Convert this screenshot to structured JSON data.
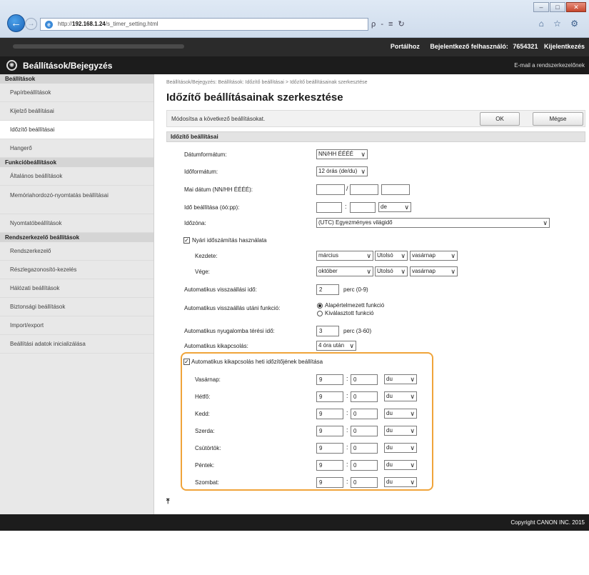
{
  "browser": {
    "url_prefix": "http://",
    "url_host": "192.168.1.24",
    "url_path": "/s_timer_setting.html",
    "addr_tools": "ρ - ≡ ↻",
    "win_min": "–",
    "win_max": "□",
    "win_close": "✕",
    "tab_icons": "⌂ ☆ ⚙"
  },
  "topbar": {
    "portal": "Portálhoz",
    "login_user": "Bejelentkező felhasználó:",
    "user_id": "7654321",
    "logout": "Kijelentkezés"
  },
  "header": {
    "title": "Beállítások/Bejegyzés",
    "mail": "E-mail a rendszerkezelőnek"
  },
  "sidebar": {
    "sections": [
      {
        "heading": "Beállítások",
        "items": [
          {
            "label": "Papírbeállítások"
          },
          {
            "label": "Kijelző beállításai"
          },
          {
            "label": "Időzítő beállításai",
            "active": true
          },
          {
            "label": "Hangerő"
          }
        ]
      },
      {
        "heading": "Funkcióbeállítások",
        "items": [
          {
            "label": "Általános beállítások"
          },
          {
            "label": "Memóriahordozó-nyomtatás beállításai"
          },
          {
            "label": "Nyomtatóbeállítások"
          }
        ]
      },
      {
        "heading": "Rendszerkezelő beállítások",
        "items": [
          {
            "label": "Rendszerkezelő"
          },
          {
            "label": "Részlegazonosító-kezelés"
          },
          {
            "label": "Hálózati beállítások"
          },
          {
            "label": "Biztonsági beállítások"
          },
          {
            "label": "Import/export"
          },
          {
            "label": "Beállítási adatok inicializálása"
          }
        ]
      }
    ]
  },
  "main": {
    "breadcrumb": "Beállítások/Bejegyzés: Beállítások: Időzítő beállításai > Időzítő beállításainak szerkesztése",
    "title": "Időzítő beállításainak szerkesztése",
    "info": "Módosítsa a következő beállításokat.",
    "ok": "OK",
    "cancel": "Mégse",
    "section_title": "Időzítő beállításai",
    "fields": {
      "date_format": {
        "label": "Dátumformátum:",
        "value": "NN/HH ÉÉÉÉ"
      },
      "time_format": {
        "label": "Időformátum:",
        "value": "12 órás (de/du)"
      },
      "today": {
        "label": "Mai dátum (NN/HH ÉÉÉÉ):",
        "sep": "/"
      },
      "time_set": {
        "label": "Idő beállítása (óó:pp):",
        "sep": ":",
        "ampm": "de"
      },
      "timezone": {
        "label": "Időzóna:",
        "value": "(UTC) Egyezményes világidő"
      },
      "dst": {
        "label": "Nyári időszámítás használata",
        "checked": "✓",
        "start_label": "Kezdete:",
        "start_month": "március",
        "start_week": "Utolsó",
        "start_day": "vasárnap",
        "end_label": "Vége:",
        "end_month": "október",
        "end_week": "Utolsó",
        "end_day": "vasárnap"
      },
      "auto_reset": {
        "label": "Automatikus visszaállási idő:",
        "value": "2",
        "unit": "perc (0-9)"
      },
      "after_reset": {
        "label": "Automatikus visszaállás utáni funkció:",
        "opt1": "Alapértelmezett funkció",
        "opt2": "Kiválasztott funkció"
      },
      "sleep": {
        "label": "Automatikus nyugalomba térési idő:",
        "value": "3",
        "unit": "perc (3-60)"
      },
      "shutdown": {
        "label": "Automatikus kikapcsolás:",
        "value": "4 óra után"
      }
    },
    "schedule": {
      "label": "Automatikus kikapcsolás heti időzítőjének beállítása",
      "checked": "✓",
      "sep": ":",
      "days": [
        {
          "label": "Vasárnap:",
          "hour": "9",
          "minute": "0",
          "ampm": "du"
        },
        {
          "label": "Hétfő:",
          "hour": "9",
          "minute": "0",
          "ampm": "du"
        },
        {
          "label": "Kedd:",
          "hour": "9",
          "minute": "0",
          "ampm": "du"
        },
        {
          "label": "Szerda:",
          "hour": "9",
          "minute": "0",
          "ampm": "du"
        },
        {
          "label": "Csütörtök:",
          "hour": "9",
          "minute": "0",
          "ampm": "du"
        },
        {
          "label": "Péntek:",
          "hour": "9",
          "minute": "0",
          "ampm": "du"
        },
        {
          "label": "Szombat:",
          "hour": "9",
          "minute": "0",
          "ampm": "du"
        }
      ]
    },
    "to_top": "⤒"
  },
  "footer": {
    "copyright": "Copyright CANON INC. 2015"
  }
}
